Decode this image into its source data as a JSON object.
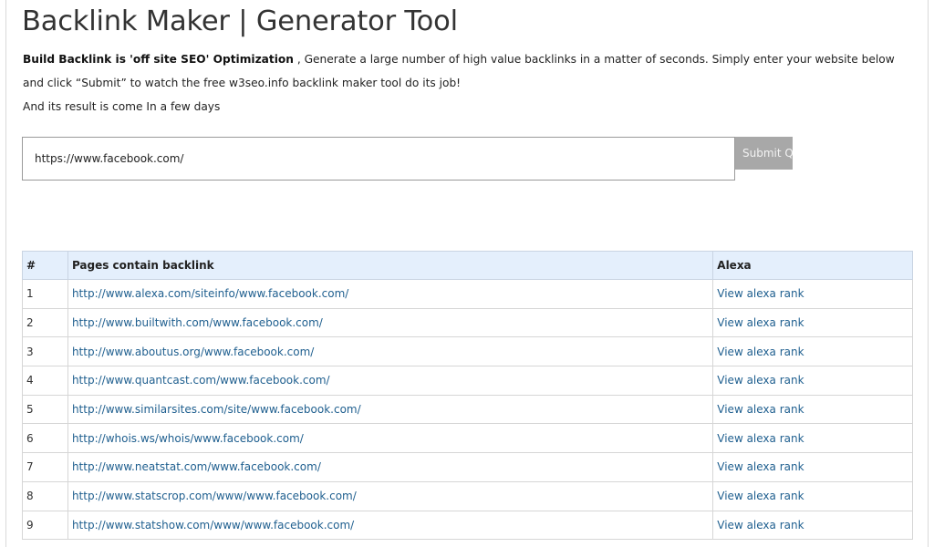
{
  "header": {
    "title": "Backlink Maker | Generator Tool"
  },
  "intro": {
    "bold_text": "Build Backlink is 'off site SEO' Optimization",
    "body_text": " , Generate a large number of high value backlinks in a matter of seconds. Simply enter your website below and click “Submit” to watch the free w3seo.info backlink maker tool do its job!",
    "second_line": "And its result is come In a few days"
  },
  "form": {
    "url_value": "https://www.facebook.com/",
    "submit_label": "Submit Query"
  },
  "table": {
    "headers": [
      "#",
      "Pages contain backlink",
      "Alexa"
    ],
    "rows": [
      {
        "num": "1",
        "page": "http://www.alexa.com/siteinfo/www.facebook.com/",
        "alexa": "View alexa rank"
      },
      {
        "num": "2",
        "page": "http://www.builtwith.com/www.facebook.com/",
        "alexa": "View alexa rank"
      },
      {
        "num": "3",
        "page": "http://www.aboutus.org/www.facebook.com/",
        "alexa": "View alexa rank"
      },
      {
        "num": "4",
        "page": "http://www.quantcast.com/www.facebook.com/",
        "alexa": "View alexa rank"
      },
      {
        "num": "5",
        "page": "http://www.similarsites.com/site/www.facebook.com/",
        "alexa": "View alexa rank"
      },
      {
        "num": "6",
        "page": "http://whois.ws/whois/www.facebook.com/",
        "alexa": "View alexa rank"
      },
      {
        "num": "7",
        "page": "http://www.neatstat.com/www.facebook.com/",
        "alexa": "View alexa rank"
      },
      {
        "num": "8",
        "page": "http://www.statscrop.com/www/www.facebook.com/",
        "alexa": "View alexa rank"
      },
      {
        "num": "9",
        "page": "http://www.statshow.com/www/www.facebook.com/",
        "alexa": "View alexa rank"
      }
    ]
  },
  "colors": {
    "link": "#1f5f8f",
    "table_header_bg": "#e4effc",
    "submit_bg": "#a8a8a8"
  }
}
